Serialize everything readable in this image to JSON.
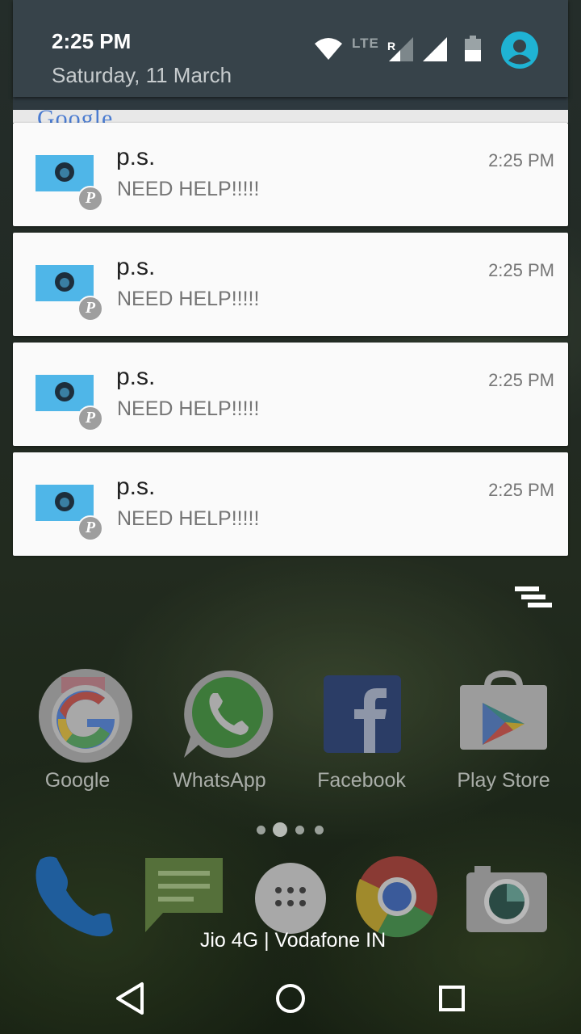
{
  "status": {
    "time": "2:25 PM",
    "date": "Saturday, 11 March",
    "network_label": "LTE",
    "roaming_mark": "R",
    "icons": [
      "wifi-icon",
      "signal-roaming-icon",
      "signal-icon",
      "battery-icon",
      "user-avatar-icon"
    ],
    "avatar_color": "#1fb3d4"
  },
  "peek_text": "Google",
  "notifications": [
    {
      "app_badge": "P",
      "title": "p.s.",
      "text": "NEED HELP!!!!!",
      "time": "2:25 PM"
    },
    {
      "app_badge": "P",
      "title": "p.s.",
      "text": "NEED HELP!!!!!",
      "time": "2:25 PM"
    },
    {
      "app_badge": "P",
      "title": "p.s.",
      "text": "NEED HELP!!!!!",
      "time": "2:25 PM"
    },
    {
      "app_badge": "P",
      "title": "p.s.",
      "text": "NEED HELP!!!!!",
      "time": "2:25 PM"
    }
  ],
  "clear_all_icon": "clear-all-icon",
  "home_apps": [
    {
      "label": "Google",
      "icon": "google-icon"
    },
    {
      "label": "WhatsApp",
      "icon": "whatsapp-icon"
    },
    {
      "label": "Facebook",
      "icon": "facebook-icon"
    },
    {
      "label": "Play Store",
      "icon": "play-store-icon"
    }
  ],
  "page_indicator": {
    "pages": 4,
    "current": 2
  },
  "dock": [
    "phone-icon",
    "messages-icon",
    "app-drawer-icon",
    "chrome-icon",
    "camera-icon"
  ],
  "carrier_text": "Jio 4G | Vodafone IN",
  "navigation": [
    "back-icon",
    "home-icon",
    "recents-icon"
  ]
}
